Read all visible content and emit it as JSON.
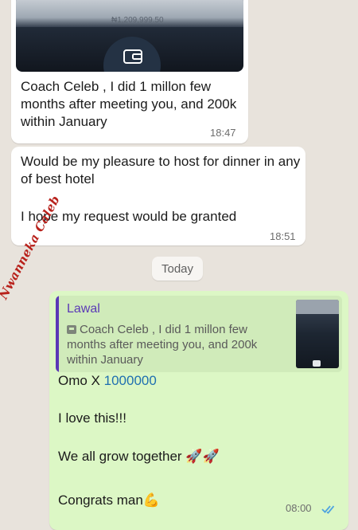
{
  "colors": {
    "chat_background": "#e8e3dc",
    "incoming_bubble": "#ffffff",
    "outgoing_bubble": "#dcf7c5",
    "quote_author": "#5b39b6",
    "link": "#1f6fb0",
    "read_ticks": "#4fa3e0",
    "watermark": "#b8211b"
  },
  "messages": {
    "first": {
      "media_amount": "₦1,209,999.50",
      "media_icon": "wallet-icon",
      "text": "Coach Celeb , I did 1 millon few months after meeting you, and 200k within January",
      "time": "18:47"
    },
    "second": {
      "line1": "Would be   my pleasure to host for dinner in any of best hotel",
      "line2": "I hope my request  would be granted",
      "time": "18:51"
    },
    "date_separator": "Today",
    "reply": {
      "quoted_author": "Lawal",
      "quoted_icon": "image-icon",
      "quoted_text_line1": "Coach Celeb , I did 1 millon few",
      "quoted_text_rest": "months after meeting you, and 200k within January",
      "line1_prefix": "Omo X ",
      "line1_number": "1000000",
      "line2": "I love this!!!",
      "line3": "We all grow together",
      "line3_emoji": "🚀🚀",
      "line4": "Congrats man",
      "line4_emoji": "💪",
      "time": "08:00",
      "status_icon": "double-check-icon"
    }
  },
  "watermark": "Nwanneka Caleb"
}
